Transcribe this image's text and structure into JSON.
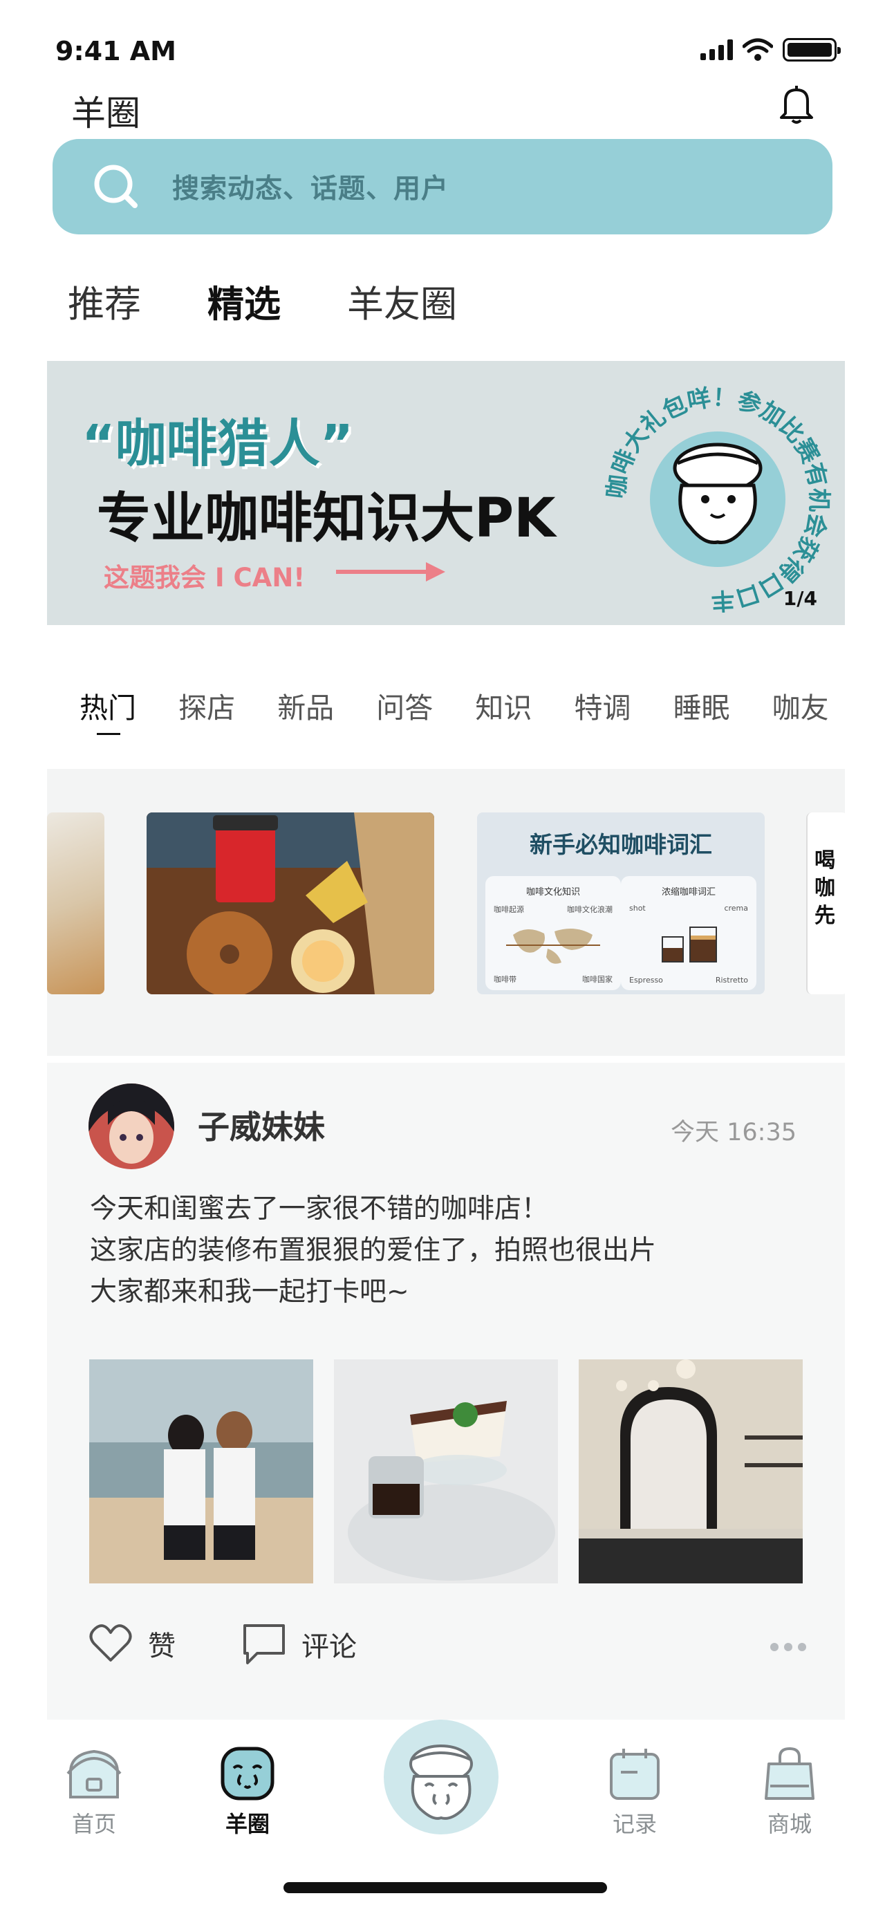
{
  "status_bar": {
    "time": "9:41 AM"
  },
  "header": {
    "title": "羊圈"
  },
  "search": {
    "placeholder": "搜索动态、话题、用户"
  },
  "top_tabs": [
    {
      "label": "推荐",
      "active": false
    },
    {
      "label": "精选",
      "active": true
    },
    {
      "label": "羊友圈",
      "active": false
    }
  ],
  "banner": {
    "quote": "“咖啡猎人”",
    "headline": "专业咖啡知识大PK",
    "cta": "这题我会 I CAN!",
    "badge_text": "咖啡大礼包咩！参加比赛有机会获得口口丰",
    "page_indicator": "1/4"
  },
  "category_tabs": [
    {
      "label": "热门",
      "active": true
    },
    {
      "label": "探店",
      "active": false
    },
    {
      "label": "新品",
      "active": false
    },
    {
      "label": "问答",
      "active": false
    },
    {
      "label": "知识",
      "active": false
    },
    {
      "label": "特调",
      "active": false
    },
    {
      "label": "睡眠",
      "active": false
    },
    {
      "label": "咖友",
      "active": false
    }
  ],
  "carousel": {
    "card3": {
      "title": "新手必知咖啡词汇",
      "panel_left": {
        "caption": "咖啡文化知识",
        "tl": "咖啡起源",
        "tr": "咖啡文化浪潮",
        "bl": "咖啡带",
        "br": "咖啡国家"
      },
      "panel_right": {
        "caption": "浓缩咖啡词汇",
        "tl": "shot",
        "tr": "crema",
        "bl": "Espresso",
        "br": "Ristretto"
      }
    },
    "card4": {
      "line1": "喝咖",
      "line2": "先"
    }
  },
  "post": {
    "username": "子威妹妹",
    "time": "今天 16:35",
    "lines": [
      "今天和闺蜜去了一家很不错的咖啡店！",
      "这家店的装修布置狠狠的爱住了，拍照也很出片",
      "大家都来和我一起打卡吧~"
    ],
    "actions": {
      "like": "赞",
      "comment": "评论"
    }
  },
  "bottom_nav": [
    {
      "label": "首页",
      "icon": "home-icon",
      "active": false
    },
    {
      "label": "羊圈",
      "icon": "sheep-circle-icon",
      "active": true
    },
    {
      "label": "",
      "icon": "sheep-mascot-icon",
      "active": false
    },
    {
      "label": "记录",
      "icon": "calendar-icon",
      "active": false
    },
    {
      "label": "商城",
      "icon": "shopping-bag-icon",
      "active": false
    }
  ],
  "colors": {
    "accent": "#96cfd7",
    "accent_dark": "#2b8f96",
    "cta_pink": "#ec7f88",
    "banner_bg": "#d9e1e2"
  }
}
